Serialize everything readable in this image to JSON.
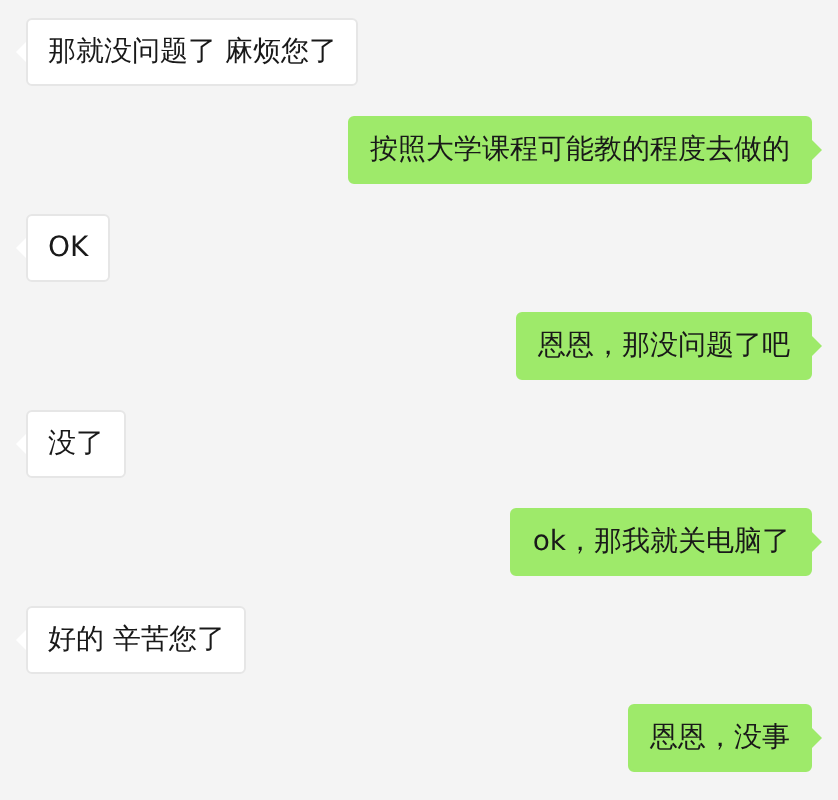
{
  "messages": [
    {
      "kind": "received",
      "text": "那就没问题了 麻烦您了"
    },
    {
      "kind": "sent",
      "text": "按照大学课程可能教的程度去做的"
    },
    {
      "kind": "received",
      "text": "OK"
    },
    {
      "kind": "sent",
      "text": "恩恩，那没问题了吧"
    },
    {
      "kind": "received",
      "text": "没了"
    },
    {
      "kind": "sent",
      "text": "ok，那我就关电脑了"
    },
    {
      "kind": "received",
      "text": "好的 辛苦您了"
    },
    {
      "kind": "sent",
      "text": "恩恩，没事"
    }
  ]
}
